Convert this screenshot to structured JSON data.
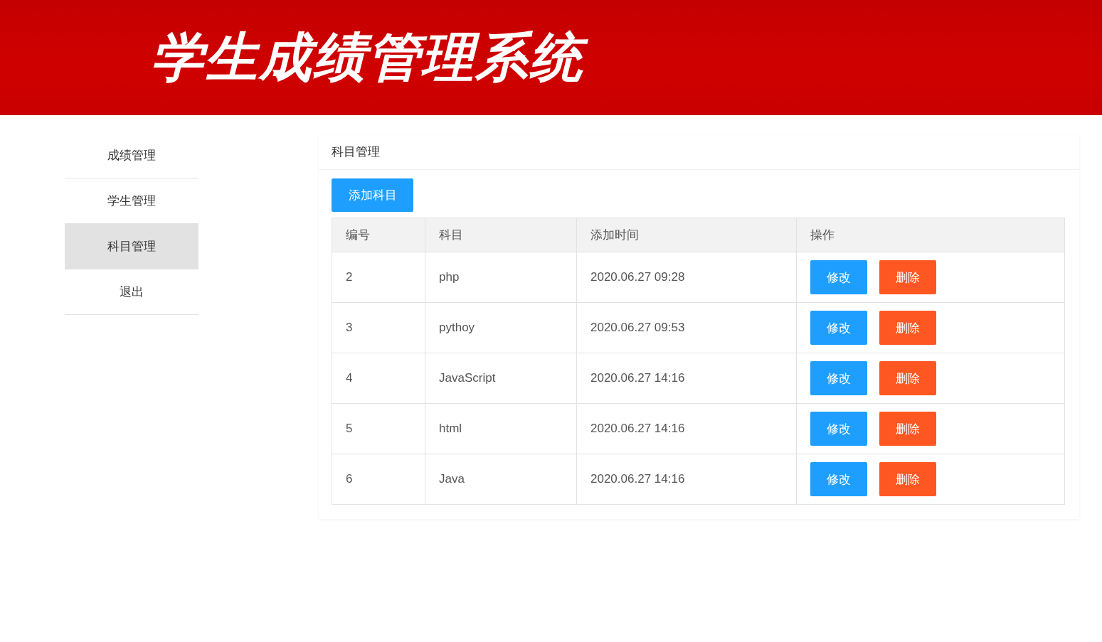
{
  "header": {
    "title": "学生成绩管理系统"
  },
  "sidebar": {
    "items": [
      {
        "label": "成绩管理",
        "selected": false
      },
      {
        "label": "学生管理",
        "selected": false
      },
      {
        "label": "科目管理",
        "selected": true
      },
      {
        "label": "退出",
        "selected": false
      }
    ]
  },
  "panel": {
    "title": "科目管理",
    "add_button": "添加科目",
    "table": {
      "columns": [
        "编号",
        "科目",
        "添加时间",
        "操作"
      ],
      "rows": [
        {
          "cells": [
            "2",
            "php",
            "2020.06.27 09:28"
          ],
          "actions": [
            {
              "label": "修改",
              "kind": "edit"
            },
            {
              "label": "删除",
              "kind": "delete"
            }
          ]
        },
        {
          "cells": [
            "3",
            "pythoy",
            "2020.06.27 09:53"
          ],
          "actions": [
            {
              "label": "修改",
              "kind": "edit"
            },
            {
              "label": "删除",
              "kind": "delete"
            }
          ]
        },
        {
          "cells": [
            "4",
            "JavaScript",
            "2020.06.27 14:16"
          ],
          "actions": [
            {
              "label": "修改",
              "kind": "edit"
            },
            {
              "label": "删除",
              "kind": "delete"
            }
          ]
        },
        {
          "cells": [
            "5",
            "html",
            "2020.06.27 14:16"
          ],
          "actions": [
            {
              "label": "修改",
              "kind": "edit"
            },
            {
              "label": "删除",
              "kind": "delete"
            }
          ]
        },
        {
          "cells": [
            "6",
            "Java",
            "2020.06.27 14:16"
          ],
          "actions": [
            {
              "label": "修改",
              "kind": "edit"
            },
            {
              "label": "删除",
              "kind": "delete"
            }
          ]
        }
      ]
    }
  }
}
